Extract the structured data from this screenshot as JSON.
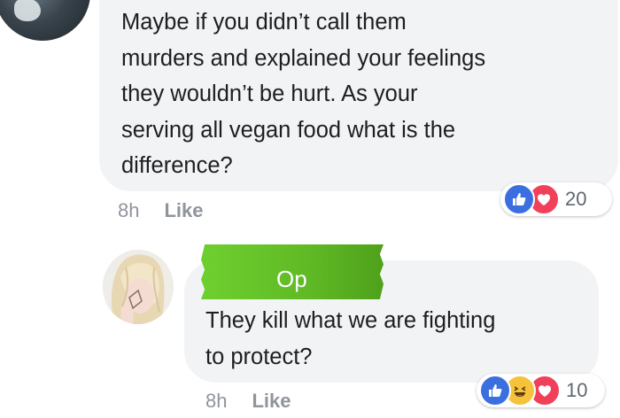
{
  "comments": [
    {
      "text": "Maybe if you didn’t call them\nmurders and explained your feelings\nthey wouldn’t be hurt. As your\nserving all vegan food what is the\ndifference?",
      "time": "8h",
      "like_label": "Like",
      "reactions": [
        "like-icon",
        "love-icon"
      ],
      "reaction_count": "20"
    },
    {
      "badge": "Op",
      "text": "They kill what we are fighting\nto protect?",
      "time": "8h",
      "like_label": "Like",
      "reactions": [
        "like-icon",
        "haha-icon",
        "love-icon"
      ],
      "reaction_count": "10"
    }
  ],
  "colors": {
    "bubble": "#f2f3f5",
    "meta_text": "#90949c",
    "like_blue": "#3b6fe0",
    "love_red": "#f0405a",
    "haha_yellow": "#f5c33b",
    "op_green": "#5fb925"
  }
}
